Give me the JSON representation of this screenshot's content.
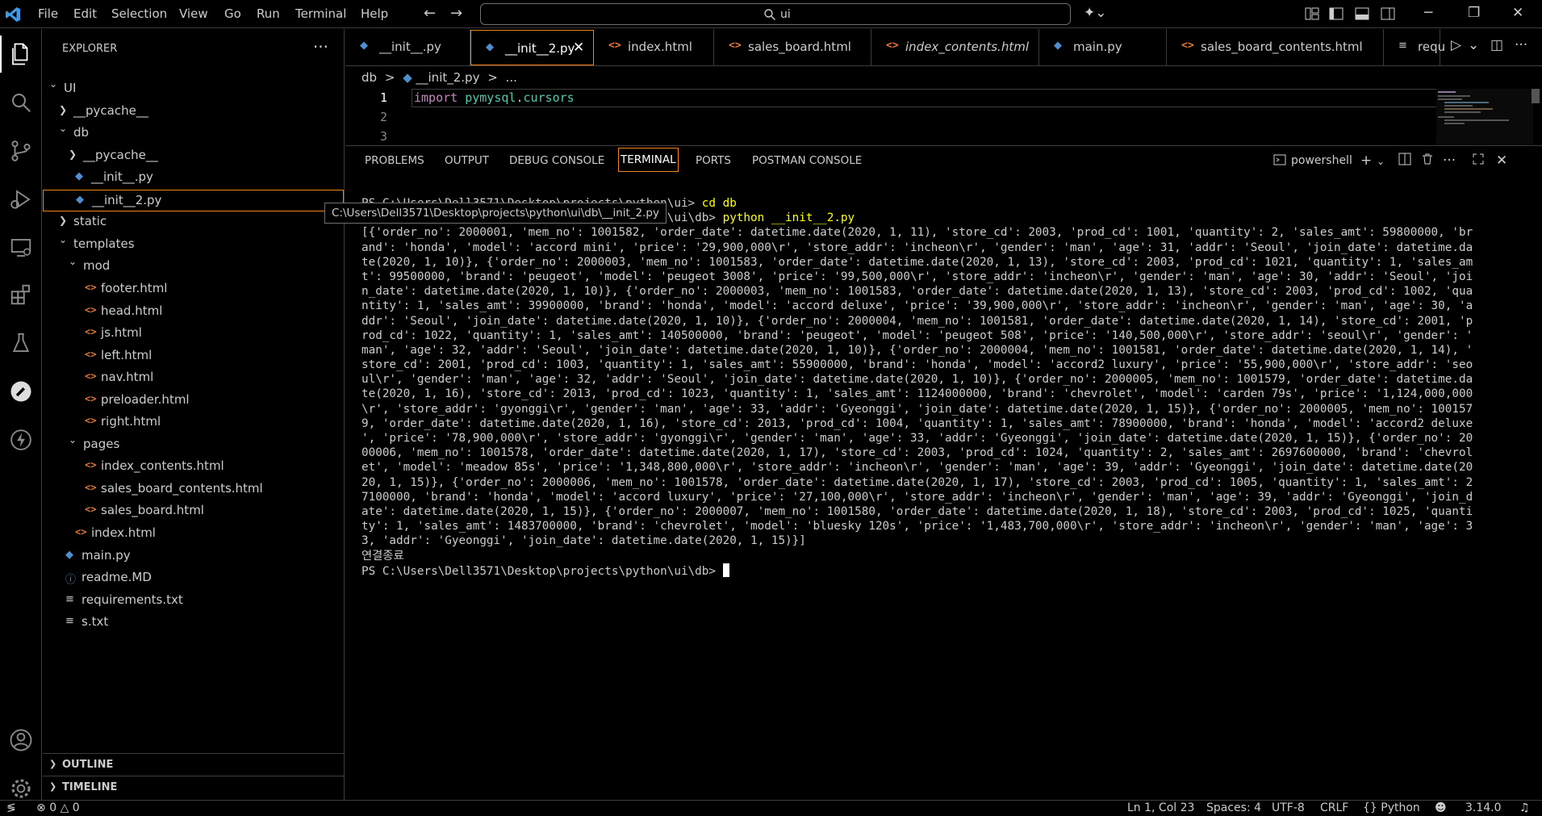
{
  "menu": [
    "File",
    "Edit",
    "Selection",
    "View",
    "Go",
    "Run",
    "Terminal",
    "Help"
  ],
  "search": {
    "text": "ui"
  },
  "sidebar": {
    "title": "EXPLORER",
    "tree": [
      {
        "label": "UI",
        "depth": 0,
        "kind": "folder-open",
        "icon": "none"
      },
      {
        "label": "__pycache__",
        "depth": 1,
        "kind": "folder",
        "icon": "none"
      },
      {
        "label": "db",
        "depth": 1,
        "kind": "folder-open",
        "icon": "none"
      },
      {
        "label": "__pycache__",
        "depth": 2,
        "kind": "folder",
        "icon": "none"
      },
      {
        "label": "__init__.py",
        "depth": 2,
        "kind": "file",
        "icon": "py"
      },
      {
        "label": "__init__2.py",
        "depth": 2,
        "kind": "file",
        "icon": "py",
        "selected": true
      },
      {
        "label": "static",
        "depth": 1,
        "kind": "folder",
        "icon": "none"
      },
      {
        "label": "templates",
        "depth": 1,
        "kind": "folder-open",
        "icon": "none"
      },
      {
        "label": "mod",
        "depth": 2,
        "kind": "folder-open",
        "icon": "none"
      },
      {
        "label": "footer.html",
        "depth": 3,
        "kind": "file",
        "icon": "html"
      },
      {
        "label": "head.html",
        "depth": 3,
        "kind": "file",
        "icon": "html"
      },
      {
        "label": "js.html",
        "depth": 3,
        "kind": "file",
        "icon": "html"
      },
      {
        "label": "left.html",
        "depth": 3,
        "kind": "file",
        "icon": "html"
      },
      {
        "label": "nav.html",
        "depth": 3,
        "kind": "file",
        "icon": "html"
      },
      {
        "label": "preloader.html",
        "depth": 3,
        "kind": "file",
        "icon": "html"
      },
      {
        "label": "right.html",
        "depth": 3,
        "kind": "file",
        "icon": "html"
      },
      {
        "label": "pages",
        "depth": 2,
        "kind": "folder-open",
        "icon": "none"
      },
      {
        "label": "index_contents.html",
        "depth": 3,
        "kind": "file",
        "icon": "html"
      },
      {
        "label": "sales_board_contents.html",
        "depth": 3,
        "kind": "file",
        "icon": "html"
      },
      {
        "label": "sales_board.html",
        "depth": 3,
        "kind": "file",
        "icon": "html"
      },
      {
        "label": "index.html",
        "depth": 2,
        "kind": "file",
        "icon": "html"
      },
      {
        "label": "main.py",
        "depth": 1,
        "kind": "file",
        "icon": "py"
      },
      {
        "label": "readme.MD",
        "depth": 1,
        "kind": "file",
        "icon": "info"
      },
      {
        "label": "requirements.txt",
        "depth": 1,
        "kind": "file",
        "icon": "txt"
      },
      {
        "label": "s.txt",
        "depth": 1,
        "kind": "file",
        "icon": "txt"
      }
    ],
    "sections": [
      "OUTLINE",
      "TIMELINE"
    ]
  },
  "tabs": [
    {
      "label": "__init__.py",
      "icon": "py",
      "active": false,
      "italic": false
    },
    {
      "label": "__init__2.py",
      "icon": "py",
      "active": true,
      "italic": false
    },
    {
      "label": "index.html",
      "icon": "html",
      "active": false,
      "italic": false
    },
    {
      "label": "sales_board.html",
      "icon": "html",
      "active": false,
      "italic": false
    },
    {
      "label": "index_contents.html",
      "icon": "html",
      "active": false,
      "italic": true
    },
    {
      "label": "main.py",
      "icon": "py",
      "active": false,
      "italic": false
    },
    {
      "label": "sales_board_contents.html",
      "icon": "html",
      "active": false,
      "italic": false
    },
    {
      "label": "requ",
      "icon": "txt",
      "active": false,
      "italic": false
    }
  ],
  "breadcrumb": {
    "folder": "db",
    "sep": ">",
    "file": "__init_2.py",
    "more": "..."
  },
  "editor": {
    "line_numbers": [
      "1",
      "2",
      "3"
    ],
    "line1": {
      "kw": "import",
      "mod1": "pymysql",
      "dot": ".",
      "mod2": "cursors"
    }
  },
  "panel": {
    "tabs": [
      "PROBLEMS",
      "OUTPUT",
      "DEBUG CONSOLE",
      "TERMINAL",
      "PORTS",
      "POSTMAN CONSOLE"
    ],
    "active_tab": "TERMINAL",
    "shell": "powershell"
  },
  "tooltip": "C:\\Users\\Dell3571\\Desktop\\projects\\python\\ui\\db\\__init_2.py",
  "terminal": {
    "prompt": "PS C:\\Users\\Dell3571\\Desktop\\projects\\python\\ui\\db> ",
    "prompt_top": "PS C:\\Users\\Dell3571\\Desktop\\projects\\python\\ui> ",
    "cmd1": "cd db",
    "cmd2": "python __init__2.py",
    "output": [
      "[{'order_no': 2000001, 'mem_no': 1001582, 'order_date': datetime.date(2020, 1, 11), 'store_cd': 2003, 'prod_cd': 1001, 'quantity': 2, 'sales_amt': 59800000, 'br",
      "and': 'honda', 'model': 'accord mini', 'price': '29,900,000\\r', 'store_addr': 'incheon\\r', 'gender': 'man', 'age': 31, 'addr': 'Seoul', 'join_date': datetime.da",
      "te(2020, 1, 10)}, {'order_no': 2000003, 'mem_no': 1001583, 'order_date': datetime.date(2020, 1, 13), 'store_cd': 2003, 'prod_cd': 1021, 'quantity': 1, 'sales_am",
      "t': 99500000, 'brand': 'peugeot', 'model': 'peugeot 3008', 'price': '99,500,000\\r', 'store_addr': 'incheon\\r', 'gender': 'man', 'age': 30, 'addr': 'Seoul', 'joi",
      "n_date': datetime.date(2020, 1, 10)}, {'order_no': 2000003, 'mem_no': 1001583, 'order_date': datetime.date(2020, 1, 13), 'store_cd': 2003, 'prod_cd': 1002, 'qua",
      "ntity': 1, 'sales_amt': 39900000, 'brand': 'honda', 'model': 'accord deluxe', 'price': '39,900,000\\r', 'store_addr': 'incheon\\r', 'gender': 'man', 'age': 30, 'a",
      "ddr': 'Seoul', 'join_date': datetime.date(2020, 1, 10)}, {'order_no': 2000004, 'mem_no': 1001581, 'order_date': datetime.date(2020, 1, 14), 'store_cd': 2001, 'p",
      "rod_cd': 1022, 'quantity': 1, 'sales_amt': 140500000, 'brand': 'peugeot', 'model': 'peugeot 508', 'price': '140,500,000\\r', 'store_addr': 'seoul\\r', 'gender': '",
      "man', 'age': 32, 'addr': 'Seoul', 'join_date': datetime.date(2020, 1, 10)}, {'order_no': 2000004, 'mem_no': 1001581, 'order_date': datetime.date(2020, 1, 14), '",
      "store_cd': 2001, 'prod_cd': 1003, 'quantity': 1, 'sales_amt': 55900000, 'brand': 'honda', 'model': 'accord2 luxury', 'price': '55,900,000\\r', 'store_addr': 'seo",
      "ul\\r', 'gender': 'man', 'age': 32, 'addr': 'Seoul', 'join_date': datetime.date(2020, 1, 10)}, {'order_no': 2000005, 'mem_no': 1001579, 'order_date': datetime.da",
      "te(2020, 1, 16), 'store_cd': 2013, 'prod_cd': 1023, 'quantity': 1, 'sales_amt': 1124000000, 'brand': 'chevrolet', 'model': 'carden 79s', 'price': '1,124,000,000",
      "\\r', 'store_addr': 'gyonggi\\r', 'gender': 'man', 'age': 33, 'addr': 'Gyeonggi', 'join_date': datetime.date(2020, 1, 15)}, {'order_no': 2000005, 'mem_no': 100157",
      "9, 'order_date': datetime.date(2020, 1, 16), 'store_cd': 2013, 'prod_cd': 1004, 'quantity': 1, 'sales_amt': 78900000, 'brand': 'honda', 'model': 'accord2 deluxe",
      "', 'price': '78,900,000\\r', 'store_addr': 'gyonggi\\r', 'gender': 'man', 'age': 33, 'addr': 'Gyeonggi', 'join_date': datetime.date(2020, 1, 15)}, {'order_no': 20",
      "00006, 'mem_no': 1001578, 'order_date': datetime.date(2020, 1, 17), 'store_cd': 2003, 'prod_cd': 1024, 'quantity': 2, 'sales_amt': 2697600000, 'brand': 'chevrol",
      "et', 'model': 'meadow 85s', 'price': '1,348,800,000\\r', 'store_addr': 'incheon\\r', 'gender': 'man', 'age': 39, 'addr': 'Gyeonggi', 'join_date': datetime.date(20",
      "20, 1, 15)}, {'order_no': 2000006, 'mem_no': 1001578, 'order_date': datetime.date(2020, 1, 17), 'store_cd': 2003, 'prod_cd': 1005, 'quantity': 1, 'sales_amt': 2",
      "7100000, 'brand': 'honda', 'model': 'accord luxury', 'price': '27,100,000\\r', 'store_addr': 'incheon\\r', 'gender': 'man', 'age': 39, 'addr': 'Gyeonggi', 'join_d",
      "ate': datetime.date(2020, 1, 15)}, {'order_no': 2000007, 'mem_no': 1001580, 'order_date': datetime.date(2020, 1, 18), 'store_cd': 2003, 'prod_cd': 1025, 'quanti",
      "ty': 1, 'sales_amt': 1483700000, 'brand': 'chevrolet', 'model': 'bluesky 120s', 'price': '1,483,700,000\\r', 'store_addr': 'incheon\\r', 'gender': 'man', 'age': 3",
      "3, 'addr': 'Gyeonggi', 'join_date': datetime.date(2020, 1, 15)}]"
    ],
    "closing": "연결종료"
  },
  "status": {
    "errors": "0",
    "warnings": "0",
    "position": "Ln 1, Col 23",
    "spaces": "Spaces: 4",
    "encoding": "UTF-8",
    "eol": "CRLF",
    "language": "Python",
    "version": "3.14.0"
  },
  "colors": {
    "accent_border": "#f38518",
    "python_icon": "#4f8fcf",
    "html_icon": "#e37933",
    "terminal_highlight": "#ffff00",
    "keyword": "#c586c0",
    "module": "#4ec9b0"
  },
  "icons": [
    "vscode-logo",
    "files-icon",
    "search-icon",
    "source-control-icon",
    "run-debug-icon",
    "remote-explorer-icon",
    "extensions-icon",
    "testing-icon",
    "postman-icon",
    "thunder-client-icon",
    "account-icon",
    "settings-gear-icon"
  ]
}
